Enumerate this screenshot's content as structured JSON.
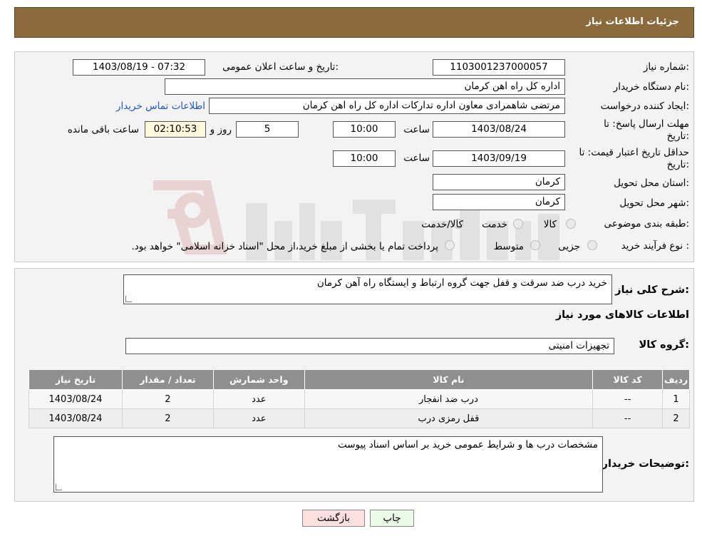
{
  "header": {
    "title": "جزئیات اطلاعات نیاز"
  },
  "form": {
    "need_number": {
      "label": "شماره نیاز:",
      "value": "1103001237000057"
    },
    "announce_datetime": {
      "label": "تاریخ و ساعت اعلان عمومی:",
      "value": "1403/08/19 - 07:32"
    },
    "buyer_org": {
      "label": "نام دستگاه خریدار:",
      "value": "اداره کل راه اهن کرمان"
    },
    "requester": {
      "label": "ایجاد کننده درخواست:",
      "value": "مرتضی  شاهمرادی  معاون اداره تدارکات  اداره کل راه اهن کرمان",
      "contact_link": "اطلاعات تماس خریدار"
    },
    "reply_deadline": {
      "label_line1": "مهلت ارسال پاسخ: تا",
      "label_line2": "تاریخ:",
      "date": "1403/08/24",
      "time_label": "ساعت",
      "time": "10:00",
      "days": "5",
      "days_label": "روز و",
      "remaining": "02:10:53",
      "remaining_label": "ساعت باقی مانده"
    },
    "price_validity": {
      "label_line1": "حداقل تاریخ اعتبار قیمت: تا",
      "label_line2": "تاریخ:",
      "date": "1403/09/19",
      "time_label": "ساعت",
      "time": "10:00"
    },
    "province": {
      "label": "استان محل تحویل:",
      "value": "کرمان"
    },
    "city": {
      "label": "شهر محل تحویل:",
      "value": "کرمان"
    },
    "category": {
      "label": "طبقه بندی موضوعی:",
      "options": [
        "کالا",
        "خدمت",
        "کالا/خدمت"
      ]
    },
    "purchase_type": {
      "label": "نوع فرآیند خرید :",
      "options": [
        "جزیی",
        "متوسط"
      ],
      "note": "پرداخت تمام یا بخشی از مبلغ خرید،از محل \"اسناد خزانه اسلامی\" خواهد بود."
    }
  },
  "details": {
    "summary_label": "شرح کلی نیاز:",
    "summary_value": "خرید درب ضد سرقت و قفل جهت گروه ارتباط و ایستگاه راه آهن کرمان",
    "goods_info_title": "اطلاعات کالاهای مورد نیاز",
    "goods_group_label": "گروه کالا:",
    "goods_group_value": "تجهیزات امنیتی",
    "table": {
      "headers": [
        "ردیف",
        "کد کالا",
        "نام کالا",
        "واحد شمارش",
        "تعداد / مقدار",
        "تاریخ نیاز"
      ],
      "rows": [
        [
          "1",
          "--",
          "درب ضد انفجار",
          "عدد",
          "2",
          "1403/08/24"
        ],
        [
          "2",
          "--",
          "قفل رمزی درب",
          "عدد",
          "2",
          "1403/08/24"
        ]
      ]
    },
    "buyer_notes_label": "توضیحات خریدار:",
    "buyer_notes_value": "مشخصات درب ها و شرایط عمومی خرید بر اساس اسناد پیوست"
  },
  "buttons": {
    "print": "چاپ",
    "back": "بازگشت"
  },
  "colors": {
    "header_bg": "#8b6b3c",
    "table_header_bg": "#8f8f8f",
    "link": "#1f55c8",
    "back_btn_bg": "#fde0e0",
    "print_btn_bg": "#eafbe6"
  }
}
